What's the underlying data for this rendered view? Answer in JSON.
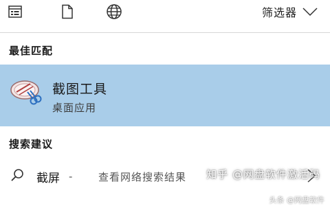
{
  "toolbar": {
    "icons": [
      "apps-icon",
      "document-icon",
      "globe-icon"
    ],
    "filter_label": "筛选器",
    "filter_icon": "chevron-down-icon"
  },
  "best_match": {
    "section_label": "最佳匹配",
    "app_name": "截图工具",
    "app_type": "桌面应用",
    "app_icon": "snipping-tool-icon",
    "highlight_color": "#a9cde9"
  },
  "suggestions": {
    "section_label": "搜索建议",
    "items": [
      {
        "term": "截屏",
        "separator": "-",
        "description": "查看网络搜索结果",
        "icon": "search-icon",
        "arrow_icon": "chevron-right-icon"
      }
    ]
  },
  "watermark": {
    "text": "知乎 @网盘软件激活码",
    "subtext": "头条 @网盘软件"
  }
}
